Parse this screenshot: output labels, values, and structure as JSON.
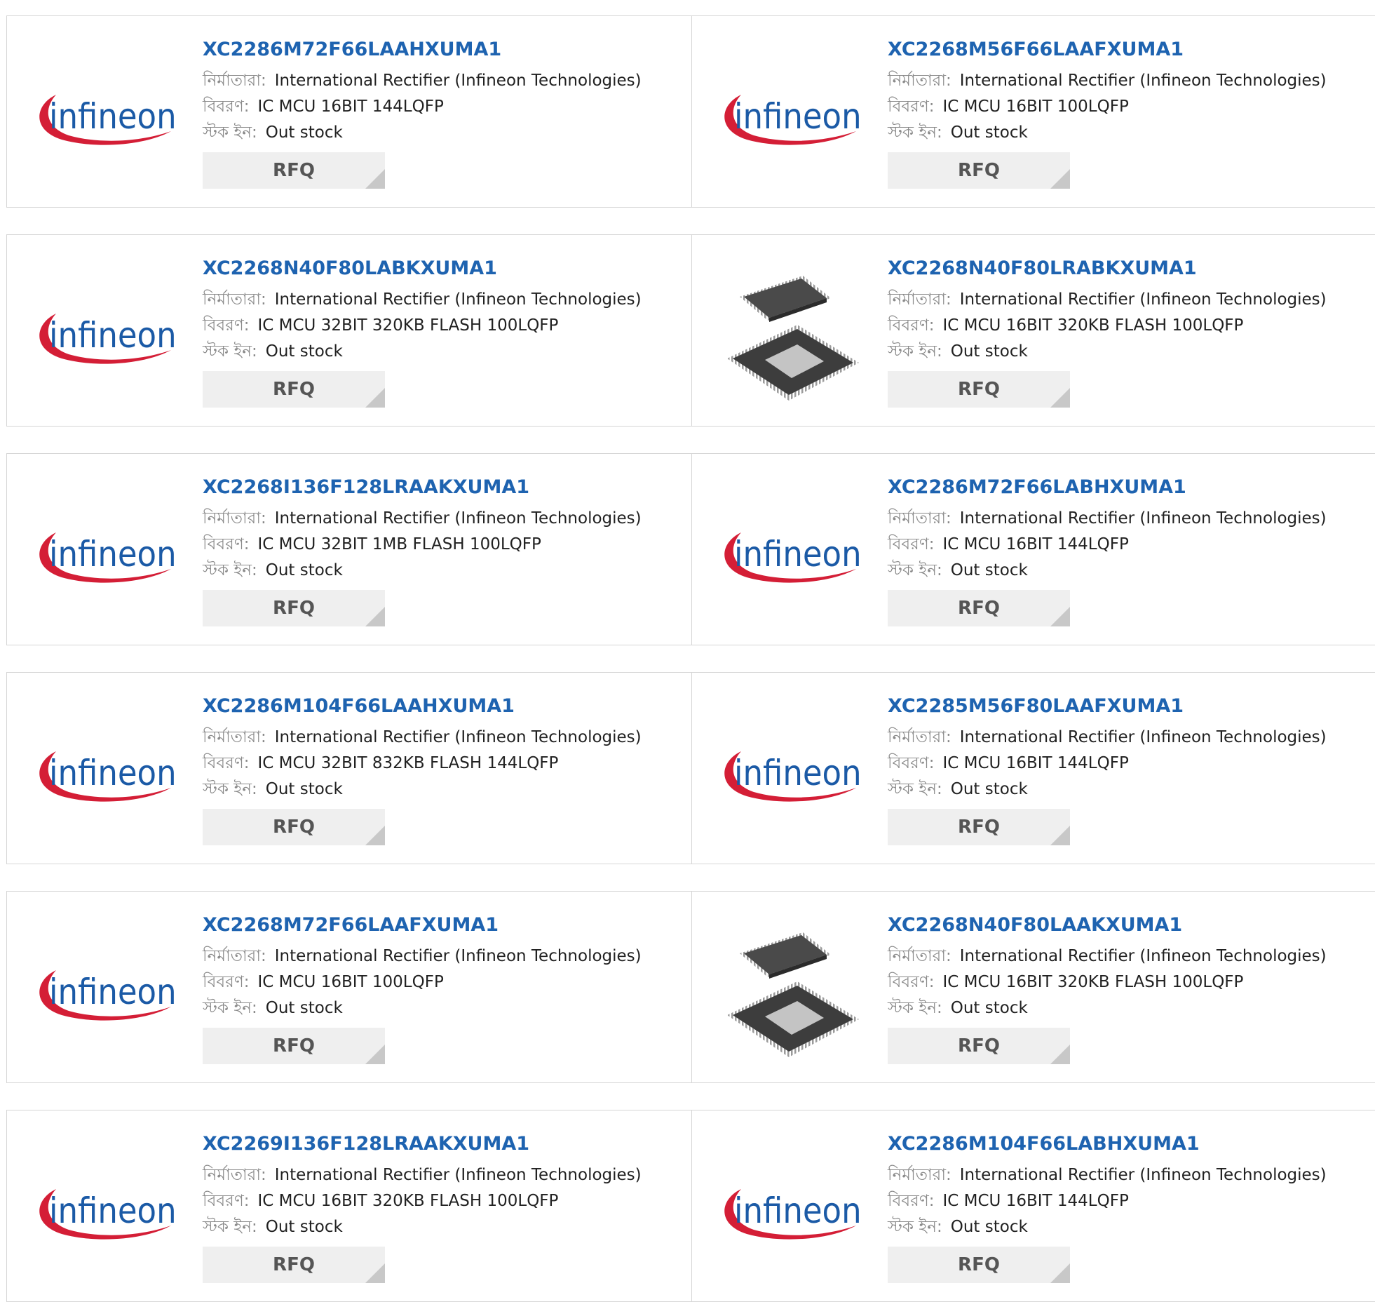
{
  "labels": {
    "manufacturer": "নির্মাতারা:",
    "description": "বিবরণ:",
    "stock": "স্টক ইন:",
    "rfq": "RFQ"
  },
  "logo_text": "infineon",
  "colors": {
    "link": "#1e63b0",
    "logo_red": "#d41e36",
    "logo_blue": "#1b5aa6",
    "button_bg": "#efefef"
  },
  "products": [
    {
      "part": "XC2286M72F66LAAHXUMA1",
      "manufacturer": "International Rectifier (Infineon Technologies)",
      "description": "IC MCU 16BIT 144LQFP",
      "stock": "Out stock",
      "image": "infineon-logo"
    },
    {
      "part": "XC2268M56F66LAAFXUMA1",
      "manufacturer": "International Rectifier (Infineon Technologies)",
      "description": "IC MCU 16BIT 100LQFP",
      "stock": "Out stock",
      "image": "infineon-logo"
    },
    {
      "part": "XC2268N40F80LABKXUMA1",
      "manufacturer": "International Rectifier (Infineon Technologies)",
      "description": "IC MCU 32BIT 320KB FLASH 100LQFP",
      "stock": "Out stock",
      "image": "infineon-logo"
    },
    {
      "part": "XC2268N40F80LRABKXUMA1",
      "manufacturer": "International Rectifier (Infineon Technologies)",
      "description": "IC MCU 16BIT 320KB FLASH 100LQFP",
      "stock": "Out stock",
      "image": "chip-photo"
    },
    {
      "part": "XC2268I136F128LRAAKXUMA1",
      "manufacturer": "International Rectifier (Infineon Technologies)",
      "description": "IC MCU 32BIT 1MB FLASH 100LQFP",
      "stock": "Out stock",
      "image": "infineon-logo"
    },
    {
      "part": "XC2286M72F66LABHXUMA1",
      "manufacturer": "International Rectifier (Infineon Technologies)",
      "description": "IC MCU 16BIT 144LQFP",
      "stock": "Out stock",
      "image": "infineon-logo"
    },
    {
      "part": "XC2286M104F66LAAHXUMA1",
      "manufacturer": "International Rectifier (Infineon Technologies)",
      "description": "IC MCU 32BIT 832KB FLASH 144LQFP",
      "stock": "Out stock",
      "image": "infineon-logo"
    },
    {
      "part": "XC2285M56F80LAAFXUMA1",
      "manufacturer": "International Rectifier (Infineon Technologies)",
      "description": "IC MCU 16BIT 144LQFP",
      "stock": "Out stock",
      "image": "infineon-logo"
    },
    {
      "part": "XC2268M72F66LAAFXUMA1",
      "manufacturer": "International Rectifier (Infineon Technologies)",
      "description": "IC MCU 16BIT 100LQFP",
      "stock": "Out stock",
      "image": "infineon-logo"
    },
    {
      "part": "XC2268N40F80LAAKXUMA1",
      "manufacturer": "International Rectifier (Infineon Technologies)",
      "description": "IC MCU 16BIT 320KB FLASH 100LQFP",
      "stock": "Out stock",
      "image": "chip-photo"
    },
    {
      "part": "XC2269I136F128LRAAKXUMA1",
      "manufacturer": "International Rectifier (Infineon Technologies)",
      "description": "IC MCU 16BIT 320KB FLASH 100LQFP",
      "stock": "Out stock",
      "image": "infineon-logo"
    },
    {
      "part": "XC2286M104F66LABHXUMA1",
      "manufacturer": "International Rectifier (Infineon Technologies)",
      "description": "IC MCU 16BIT 144LQFP",
      "stock": "Out stock",
      "image": "infineon-logo"
    }
  ]
}
